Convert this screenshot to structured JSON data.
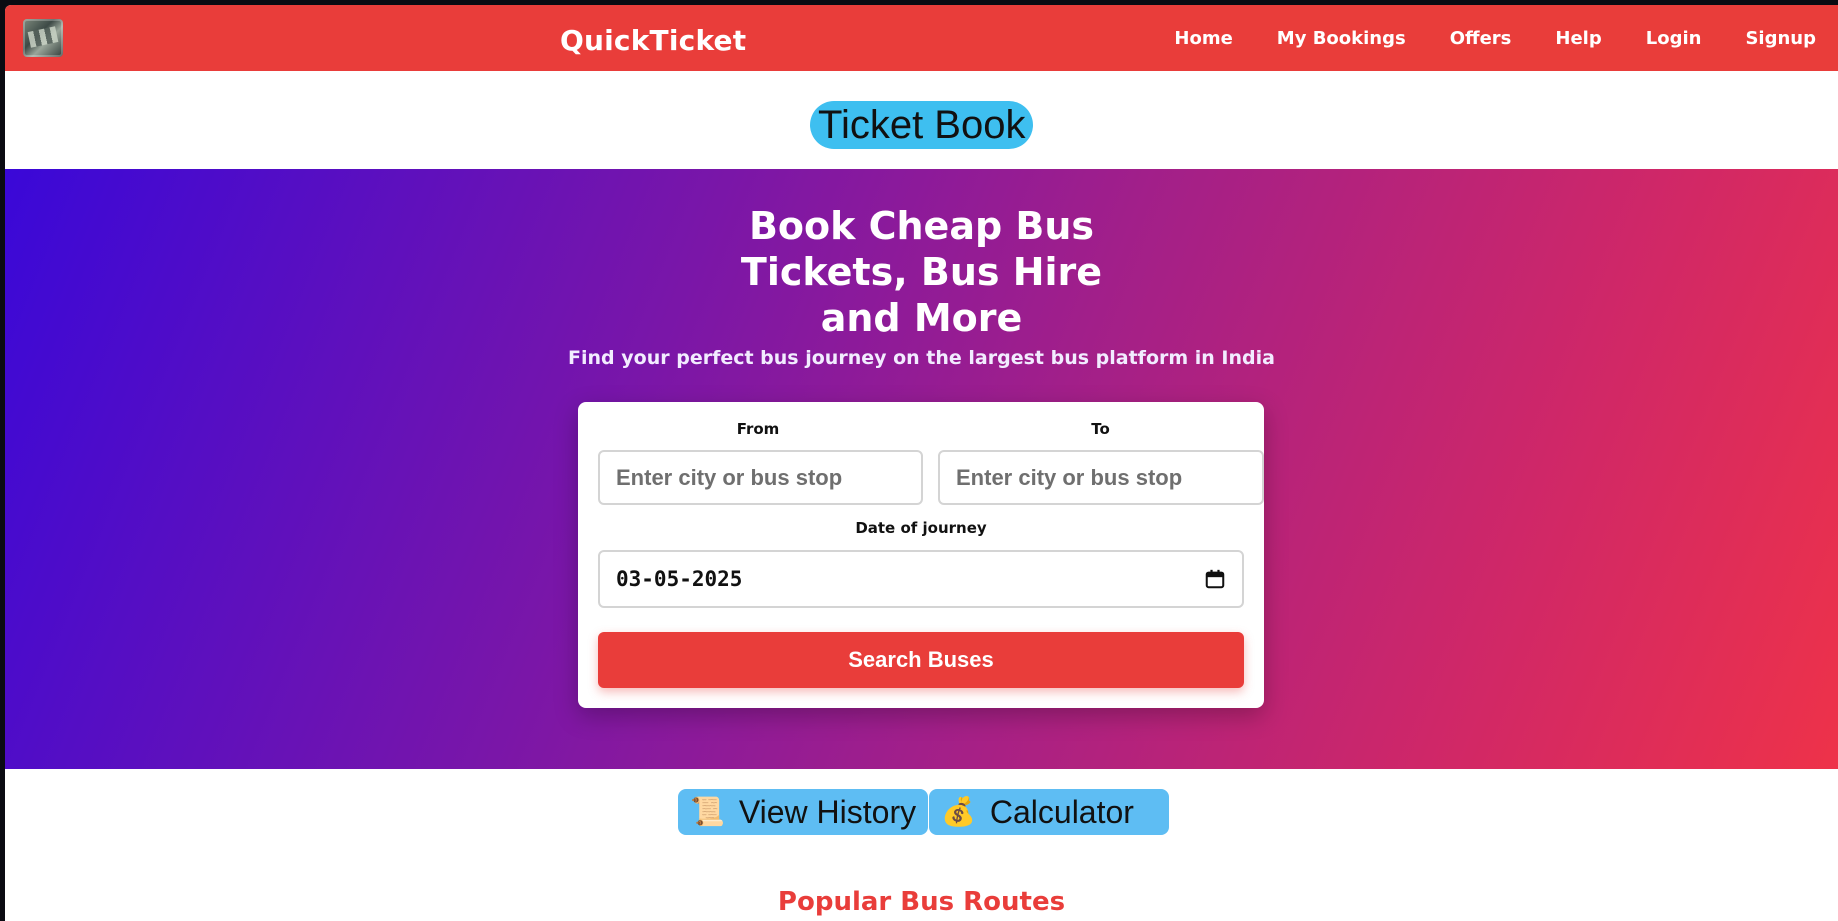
{
  "navbar": {
    "brand": "QuickTicket",
    "links": [
      "Home",
      "My Bookings",
      "Offers",
      "Help",
      "Login",
      "Signup"
    ]
  },
  "title_badge": "Ticket Book",
  "hero": {
    "title_lines": [
      "Book Cheap Bus",
      "Tickets, Bus Hire",
      "and More"
    ],
    "subtitle": "Find your perfect bus journey on the largest bus platform in India"
  },
  "search": {
    "from_label": "From",
    "from_placeholder": "Enter city or bus stop",
    "to_label": "To",
    "to_placeholder": "Enter city or bus stop",
    "date_label": "Date of journey",
    "date_value": "03-05-2025",
    "button_label": "Search Buses"
  },
  "tools": {
    "history": {
      "icon": "📜",
      "label": "View History"
    },
    "calculator": {
      "icon": "💰",
      "label": "Calculator"
    }
  },
  "routes_title": "Popular Bus Routes",
  "colors": {
    "primary_red": "#e93d3a",
    "badge_blue": "#3ebff0",
    "tool_blue": "#5ebdf3",
    "hero_start": "#3a08d8",
    "hero_end": "#ee3249"
  },
  "icons": {
    "logo": "bus-logo-icon",
    "calendar": "calendar-icon",
    "history": "scroll-icon",
    "calculator": "money-bag-icon"
  }
}
